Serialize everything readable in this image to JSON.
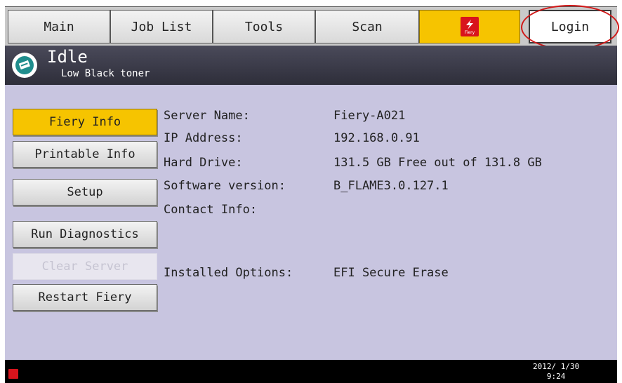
{
  "tabs": {
    "main": "Main",
    "job_list": "Job List",
    "tools": "Tools",
    "scan": "Scan",
    "fiery_logo_text": "Fiery",
    "login": "Login"
  },
  "status": {
    "title": "Idle",
    "subtitle": "Low Black toner",
    "icon": "printer-status-icon"
  },
  "sidebar": {
    "items": [
      {
        "label": "Fiery Info",
        "state": "selected"
      },
      {
        "label": "Printable Info",
        "state": "normal"
      },
      {
        "label": "Setup",
        "state": "normal"
      },
      {
        "label": "Run Diagnostics",
        "state": "normal"
      },
      {
        "label": "Clear Server",
        "state": "disabled"
      },
      {
        "label": "Restart Fiery",
        "state": "normal"
      }
    ]
  },
  "info": {
    "server_name_label": "Server Name:",
    "server_name_value": "Fiery-A021",
    "ip_label": "IP Address:",
    "ip_value": "192.168.0.91",
    "hard_drive_label": "Hard Drive:",
    "hard_drive_value": "131.5 GB Free out of 131.8 GB",
    "software_label": "Software version:",
    "software_value": "B_FLAME3.0.127.1",
    "contact_label": "Contact Info:",
    "options_label": "Installed Options:",
    "options_value": "EFI Secure Erase"
  },
  "footer": {
    "date": "2012/ 1/30",
    "time": "9:24"
  },
  "colors": {
    "accent_yellow": "#f6c400",
    "panel_lavender": "#c8c5e0",
    "header_dark": "#2e2e3a",
    "login_highlight_ring": "#d01818",
    "fiery_red": "#d8141c"
  }
}
